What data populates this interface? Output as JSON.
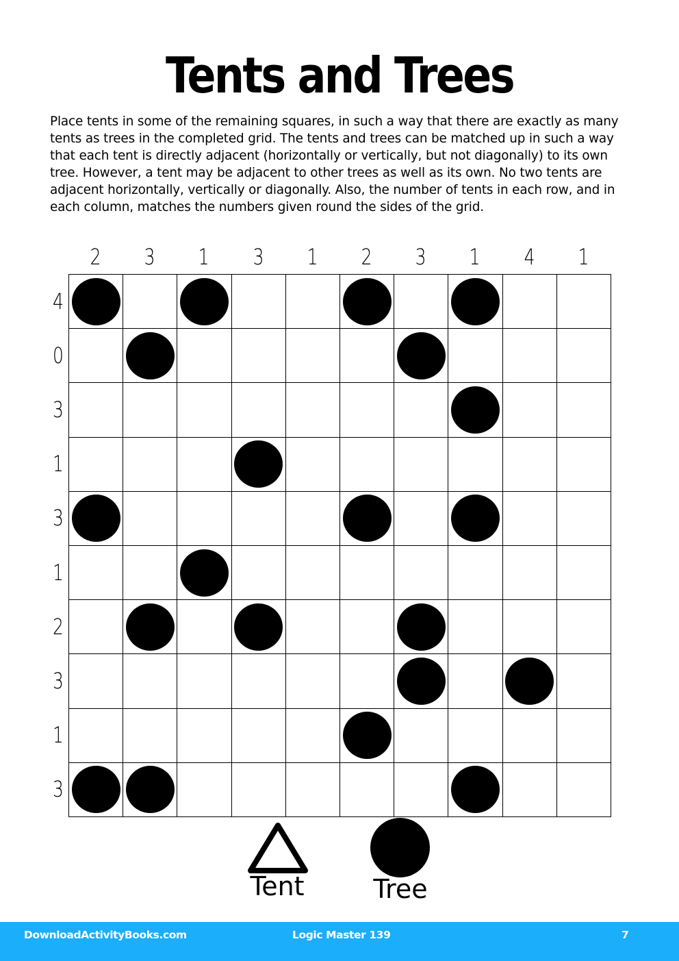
{
  "page": {
    "title": "Tents and Trees",
    "instructions": "Place tents in some of the remaining squares, in such a way that there are exactly as many tents as trees in the completed grid. The tents and trees can be matched up in such a way that each tent is directly adjacent (horizontally or vertically, but not diagonally) to its own tree. However, a tent may be adjacent to other trees as well as its own. No two tents are adjacent horizontally, vertically or diagonally. Also, the number of tents in each row, and in each column, matches the numbers given round the sides of the grid."
  },
  "puzzle": {
    "size": 10,
    "column_clues": [
      "2",
      "3",
      "1",
      "3",
      "1",
      "2",
      "3",
      "1",
      "4",
      "1"
    ],
    "row_clues": [
      "4",
      "0",
      "3",
      "1",
      "3",
      "1",
      "2",
      "3",
      "1",
      "3"
    ],
    "grid": [
      [
        1,
        0,
        1,
        0,
        0,
        1,
        0,
        1,
        0,
        0
      ],
      [
        0,
        1,
        0,
        0,
        0,
        0,
        1,
        0,
        0,
        0
      ],
      [
        0,
        0,
        0,
        0,
        0,
        0,
        0,
        1,
        0,
        0
      ],
      [
        0,
        0,
        0,
        1,
        0,
        0,
        0,
        0,
        0,
        0
      ],
      [
        1,
        0,
        0,
        0,
        0,
        1,
        0,
        1,
        0,
        0
      ],
      [
        0,
        0,
        1,
        0,
        0,
        0,
        0,
        0,
        0,
        0
      ],
      [
        0,
        1,
        0,
        1,
        0,
        0,
        1,
        0,
        0,
        0
      ],
      [
        0,
        0,
        0,
        0,
        0,
        0,
        1,
        0,
        1,
        0
      ],
      [
        0,
        0,
        0,
        0,
        0,
        1,
        0,
        0,
        0,
        0
      ],
      [
        1,
        1,
        0,
        0,
        0,
        0,
        0,
        1,
        0,
        0
      ]
    ],
    "grid_legend": {
      "0": "empty",
      "1": "tree"
    }
  },
  "legend": {
    "tent_label": "Tent",
    "tent_icon": "triangle-outline",
    "tree_label": "Tree",
    "tree_icon": "filled-circle"
  },
  "footer": {
    "site": "DownloadActivityBooks.com",
    "book": "Logic Master 139",
    "page_number": "7",
    "color": "#1aaefb"
  }
}
